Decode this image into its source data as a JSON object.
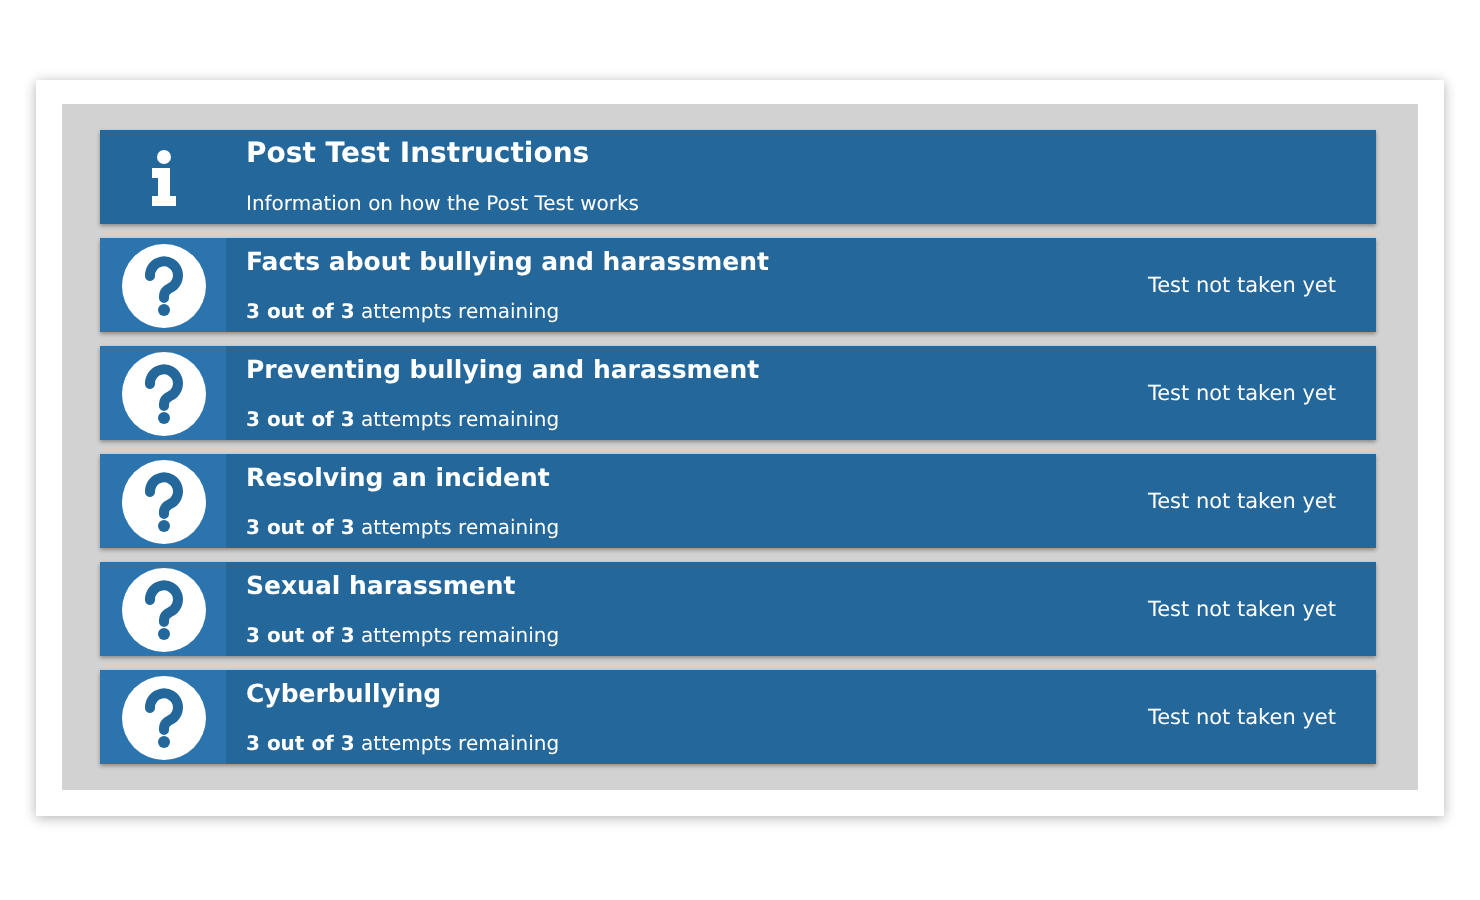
{
  "items": [
    {
      "kind": "info",
      "title": "Post Test Instructions",
      "subtitle": "Information on how the Post Test works"
    },
    {
      "kind": "test",
      "title": "Facts about bullying and harassment",
      "subtitle": "**3 out of 3** attempts remaining",
      "status": "Test not taken yet"
    },
    {
      "kind": "test",
      "title": "Preventing bullying and harassment",
      "subtitle": "**3 out of 3** attempts remaining",
      "status": "Test not taken yet"
    },
    {
      "kind": "test",
      "title": "Resolving an incident",
      "subtitle": "**3 out of 3** attempts remaining",
      "status": "Test not taken yet"
    },
    {
      "kind": "test",
      "title": "Sexual harassment",
      "subtitle": "**3 out of 3** attempts remaining",
      "status": "Test not taken yet"
    },
    {
      "kind": "test",
      "title": "Cyberbullying",
      "subtitle": "**3 out of 3** attempts remaining",
      "status": "Test not taken yet"
    }
  ]
}
